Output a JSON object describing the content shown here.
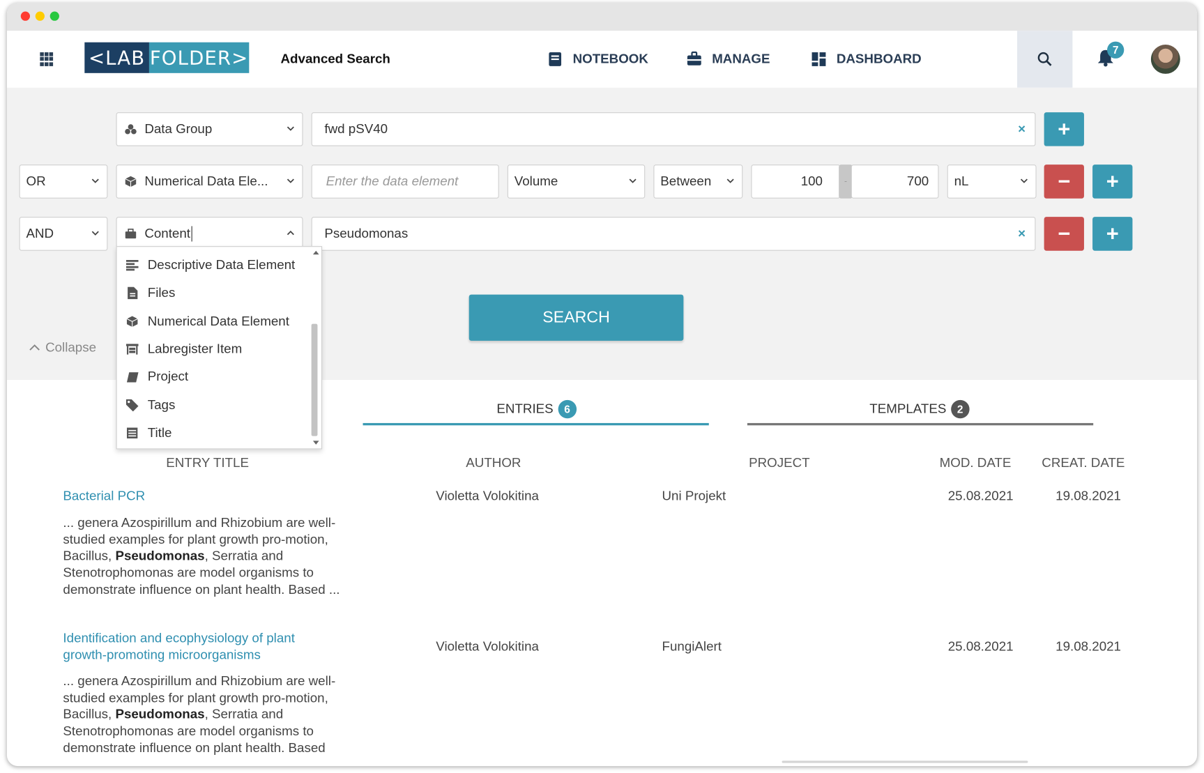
{
  "app": {
    "logo_left": "<LAB",
    "logo_right": "FOLDER>",
    "page_title": "Advanced Search"
  },
  "nav": {
    "items": [
      {
        "label": "NOTEBOOK",
        "icon": "notebook-icon"
      },
      {
        "label": "MANAGE",
        "icon": "briefcase-icon"
      },
      {
        "label": "DASHBOARD",
        "icon": "dashboard-icon"
      }
    ],
    "notification_count": "7"
  },
  "search": {
    "row1": {
      "field": "Data Group",
      "value": "fwd pSV40"
    },
    "row2": {
      "operator": "OR",
      "field": "Numerical Data Ele...",
      "placeholder": "Enter the data element",
      "quantity": "Volume",
      "comparison": "Between",
      "min": "100",
      "max": "700",
      "unit": "nL"
    },
    "row3": {
      "operator": "AND",
      "field": "Content",
      "value": "Pseudomonas"
    },
    "dropdown_options": [
      "Descriptive Data Element",
      "Files",
      "Numerical Data Element",
      "Labregister Item",
      "Project",
      "Tags",
      "Title"
    ],
    "search_button": "SEARCH",
    "collapse_label": "Collapse",
    "clear_symbol": "×",
    "plus_symbol": "+",
    "minus_symbol": "−"
  },
  "tabs": [
    {
      "label": "ENTRIES",
      "count": "6",
      "active": true
    },
    {
      "label": "TEMPLATES",
      "count": "2",
      "active": false
    }
  ],
  "table": {
    "headers": [
      "ENTRY TITLE",
      "AUTHOR",
      "PROJECT",
      "MOD. DATE",
      "CREAT. DATE"
    ],
    "rows": [
      {
        "title_lines": [
          "Bacterial PCR"
        ],
        "author": "Violetta Volokitina",
        "project": "Uni Projekt",
        "mod_date": "25.08.2021",
        "creat_date": "19.08.2021",
        "snippet_pre": "... genera Azospirillum and Rhizobium are well-studied examples for plant growth pro-motion, Bacillus, ",
        "snippet_match": "Pseudomonas",
        "snippet_post": ", Serratia and Stenotrophomonas are model organisms to demonstrate influence on plant health. Based ..."
      },
      {
        "title_lines": [
          "Identification and ecophysiology of plant",
          "growth-promoting microorganisms"
        ],
        "author": "Violetta Volokitina",
        "project": "FungiAlert",
        "mod_date": "25.08.2021",
        "creat_date": "19.08.2021",
        "snippet_pre": "... genera Azospirillum and Rhizobium are well-studied examples for plant growth pro-motion, Bacillus, ",
        "snippet_match": "Pseudomonas",
        "snippet_post": ", Serratia and Stenotrophomonas are model organisms to demonstrate influence on plant health. Based"
      }
    ]
  },
  "colors": {
    "accent": "#3a9ab3",
    "danger": "#c9504f",
    "navy": "#1c3f63",
    "link": "#2f8fb0"
  }
}
